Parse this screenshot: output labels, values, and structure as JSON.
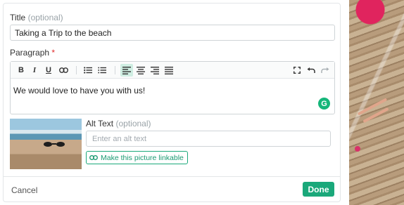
{
  "form": {
    "title_label": "Title",
    "title_optional": "(optional)",
    "title_value": "Taking a Trip to the beach",
    "paragraph_label": "Paragraph",
    "paragraph_required": "*",
    "paragraph_text": "We would love to have you with us!",
    "alt_label": "Alt Text",
    "alt_optional": "(optional)",
    "alt_placeholder": "Enter an alt text",
    "link_button_label": "Make this picture linkable"
  },
  "toolbar": {
    "bold": "B",
    "italic": "I",
    "underline": "U",
    "active_align": "align-left",
    "icons": [
      "link-icon",
      "bullet-list-icon",
      "numbered-list-icon",
      "align-left-icon",
      "align-center-icon",
      "align-right-icon",
      "align-justify-icon",
      "fullscreen-icon",
      "undo-icon",
      "redo-icon"
    ]
  },
  "grammarly": {
    "glyph": "G"
  },
  "footer": {
    "cancel_label": "Cancel",
    "done_label": "Done"
  },
  "colors": {
    "accent": "#1aa87a",
    "active_bg": "#cfeee2",
    "required": "#e02b2b"
  }
}
